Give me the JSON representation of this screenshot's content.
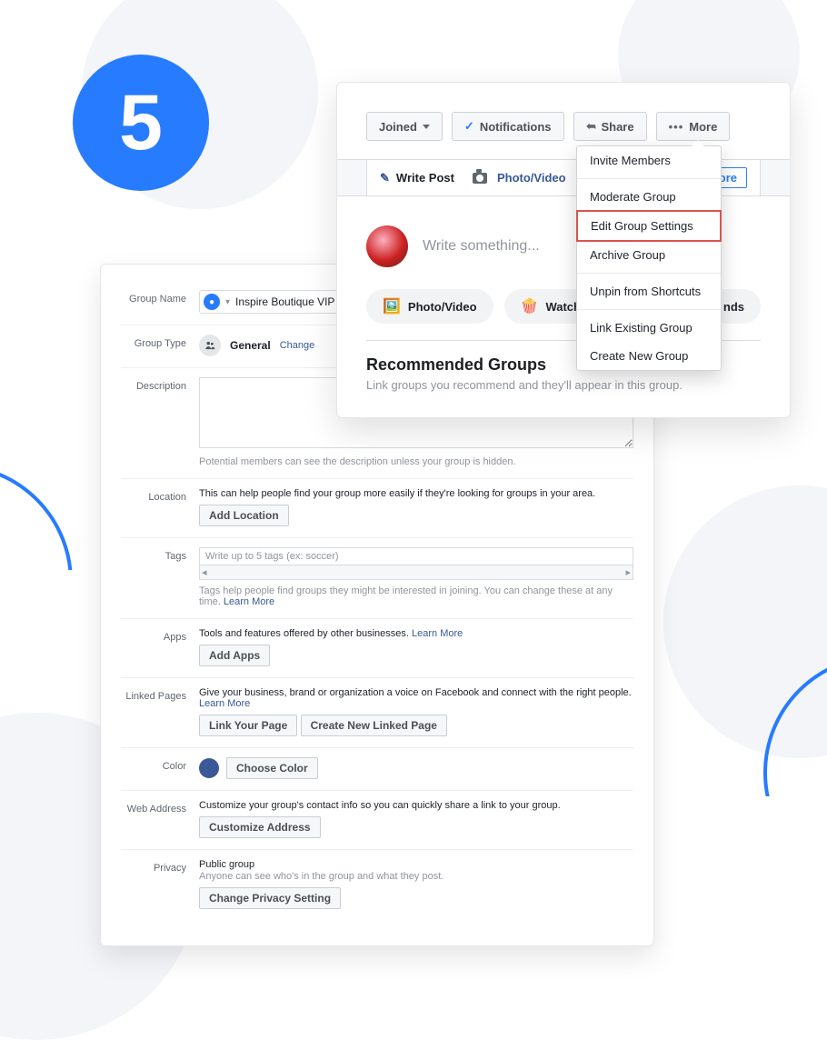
{
  "step_number": "5",
  "header": {
    "joined_btn": "Joined",
    "notifications_btn": "Notifications",
    "share_btn": "Share",
    "more_btn": "More"
  },
  "tabs": {
    "write": "Write Post",
    "photo": "Photo/Video",
    "more": "More"
  },
  "compose_placeholder": "Write something...",
  "chips": {
    "photo": "Photo/Video",
    "watch": "Watch",
    "ends_suffix": "nds"
  },
  "reco": {
    "title": "Recommended Groups",
    "desc": "Link groups you recommend and they'll appear in this group."
  },
  "menu": {
    "invite": "Invite Members",
    "moderate": "Moderate Group",
    "edit": "Edit Group Settings",
    "archive": "Archive Group",
    "unpin": "Unpin from Shortcuts",
    "link": "Link Existing Group",
    "create": "Create New Group"
  },
  "settings": {
    "group_name": {
      "label": "Group Name",
      "value": "Inspire Boutique VIP"
    },
    "group_type": {
      "label": "Group Type",
      "value": "General",
      "change": "Change"
    },
    "description": {
      "label": "Description",
      "hint": "Potential members can see the description unless your group is hidden."
    },
    "location": {
      "label": "Location",
      "text": "This can help people find your group more easily if they're looking for groups in your area.",
      "btn": "Add Location"
    },
    "tags": {
      "label": "Tags",
      "placeholder": "Write up to 5 tags (ex: soccer)",
      "hint": "Tags help people find groups they might be interested in joining. You can change these at any time.",
      "learn": "Learn More"
    },
    "apps": {
      "label": "Apps",
      "text": "Tools and features offered by other businesses.",
      "learn": "Learn More",
      "btn": "Add Apps"
    },
    "linked": {
      "label": "Linked Pages",
      "text": "Give your business, brand or organization a voice on Facebook and connect with the right people.",
      "learn": "Learn More",
      "btn1": "Link Your Page",
      "btn2": "Create New Linked Page"
    },
    "color": {
      "label": "Color",
      "btn": "Choose Color"
    },
    "web": {
      "label": "Web Address",
      "text": "Customize your group's contact info so you can quickly share a link to your group.",
      "btn": "Customize Address"
    },
    "privacy": {
      "label": "Privacy",
      "value": "Public group",
      "hint": "Anyone can see who's in the group and what they post.",
      "btn": "Change Privacy Setting"
    }
  }
}
